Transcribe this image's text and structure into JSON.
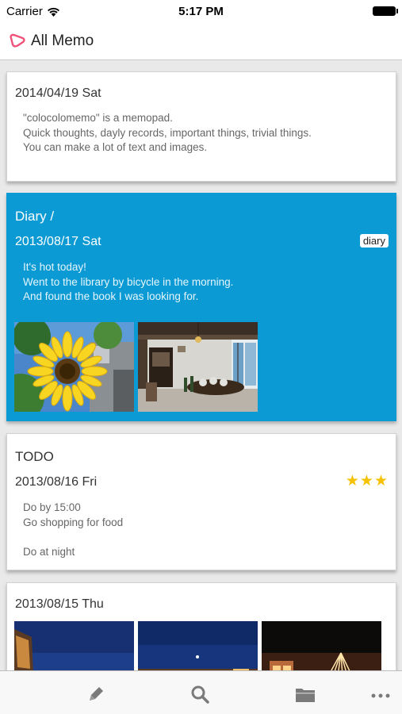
{
  "status_bar": {
    "carrier": "Carrier",
    "time": "5:17 PM"
  },
  "nav": {
    "title": "All Memo"
  },
  "memos": [
    {
      "date": "2014/04/19 Sat",
      "body": "\"colocolomemo\" is a memopad.\nQuick thoughts, dayly records, important things, trivial things.\nYou can make a lot of text and images."
    },
    {
      "category": "Diary /",
      "date": "2013/08/17 Sat",
      "tag": "diary",
      "body": "It's hot today!\nWent to the library by bicycle in the morning.\nAnd found the book I was looking for.",
      "accent": "#0b9ad4"
    },
    {
      "category": "TODO",
      "date": "2013/08/16 Fri",
      "stars": "★★★",
      "body": "Do by 15:00\nGo shopping for food\n\nDo at night"
    },
    {
      "date": "2013/08/15 Thu"
    }
  ],
  "tabbar": {
    "icons": [
      "pencil-icon",
      "search-icon",
      "folder-icon",
      "more-icon"
    ]
  }
}
